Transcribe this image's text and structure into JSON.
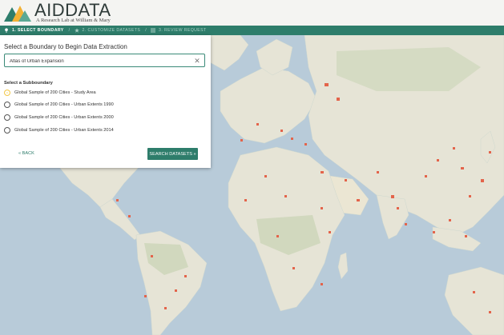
{
  "header": {
    "logo_title": "AIDDATA",
    "logo_tagline": "A Research Lab at William & Mary",
    "logo_colors": [
      "#2e7d6b",
      "#f2b134",
      "#5aa894"
    ]
  },
  "steps": [
    {
      "label": "1. SELECT BOUNDARY",
      "icon": "map-marker-icon",
      "active": true
    },
    {
      "label": "2. CUSTOMIZE DATASETS",
      "icon": "star-icon",
      "active": false
    },
    {
      "label": "3. REVIEW REQUEST",
      "icon": "list-icon",
      "active": false
    }
  ],
  "step_separator": "/",
  "panel": {
    "title": "Select a Boundary to Begin Data Extraction",
    "boundary_value": "Atlas of Urban Expansion",
    "clear_symbol": "✕",
    "subboundary_label": "Select a Subboundary",
    "options": [
      {
        "label": "Global Sample of 200 Cities - Study Area",
        "checked": true
      },
      {
        "label": "Global Sample of 200 Cities - Urban Extents 1990",
        "checked": false
      },
      {
        "label": "Global Sample of 200 Cities - Urban Extents 2000",
        "checked": false
      },
      {
        "label": "Global Sample of 200 Cities - Urban Extents 2014",
        "checked": false
      }
    ],
    "back_label": "« BACK",
    "search_label": "SEARCH DATASETS »"
  },
  "colors": {
    "accent": "#2e7d6b",
    "ocean": "#b8cbd9",
    "land": "#e6e4d6",
    "forest": "#c7d3b4",
    "city_marker": "#e3644b"
  }
}
